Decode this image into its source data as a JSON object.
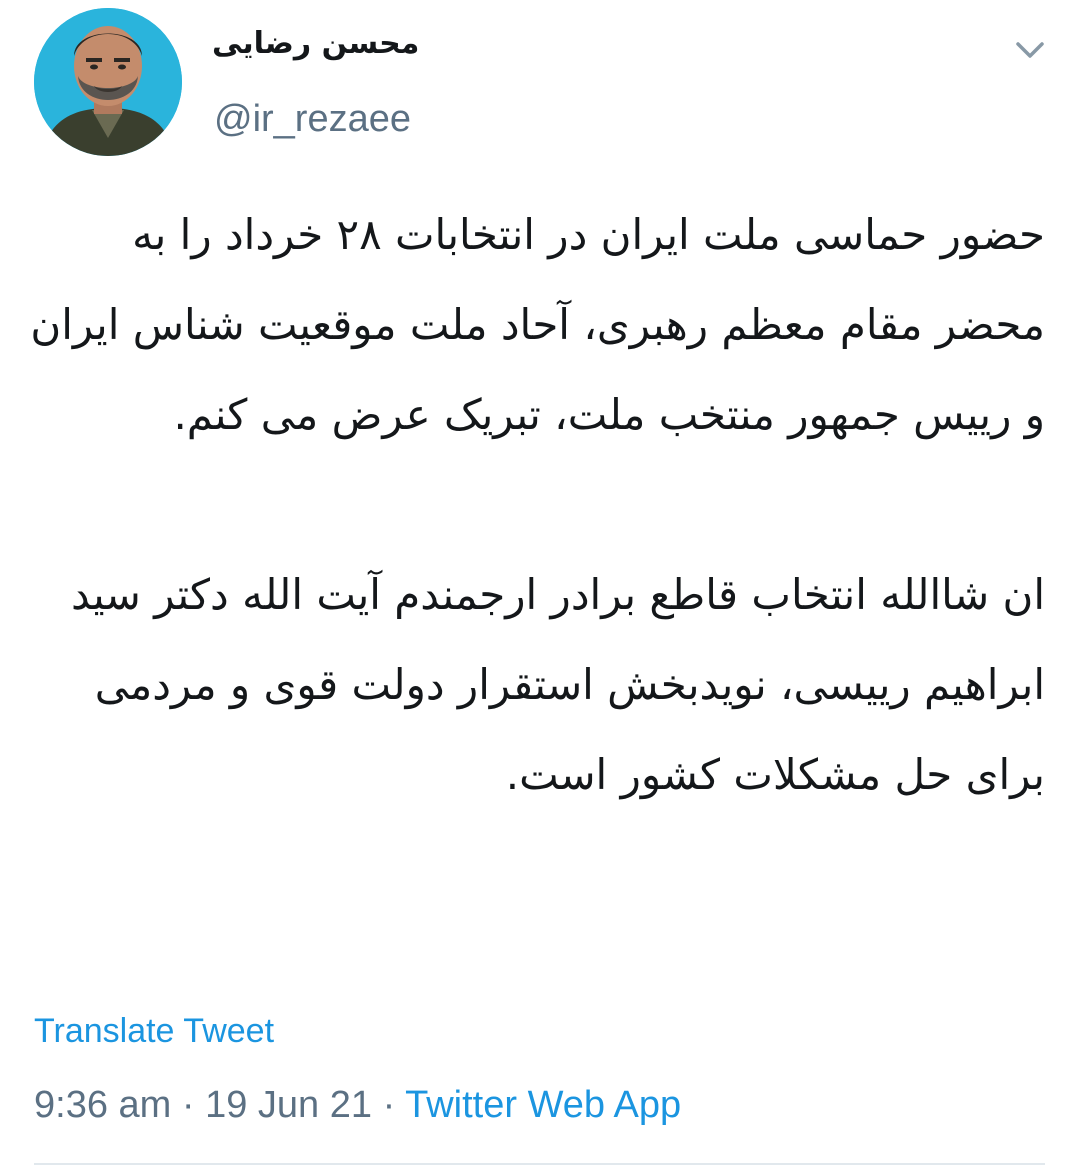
{
  "tweet": {
    "author": {
      "display_name": "محسن رضایی",
      "handle": "@ir_rezaee"
    },
    "paragraphs": [
      "حضور حماسی ملت ایران در انتخابات ۲۸ خرداد را به محضر مقام معظم رهبری، آحاد ملت موقعیت شناس ایران و رییس جمهور منتخب ملت، تبریک عرض می کنم.",
      "ان شاالله انتخاب قاطع برادر ارجمندم آیت الله دکتر سید ابراهیم رییسی، نویدبخش استقرار دولت قوی و مردمی برای حل مشکلات کشور است."
    ],
    "translate_label": "Translate Tweet",
    "time": "9:36 am",
    "separator": "·",
    "date": "19 Jun 21",
    "source": "Twitter Web App"
  },
  "icons": {
    "menu": "chevron-down-icon"
  },
  "colors": {
    "link": "#1b95e0",
    "secondary_text": "#5b7083",
    "avatar_background": "#2ab4dc"
  }
}
